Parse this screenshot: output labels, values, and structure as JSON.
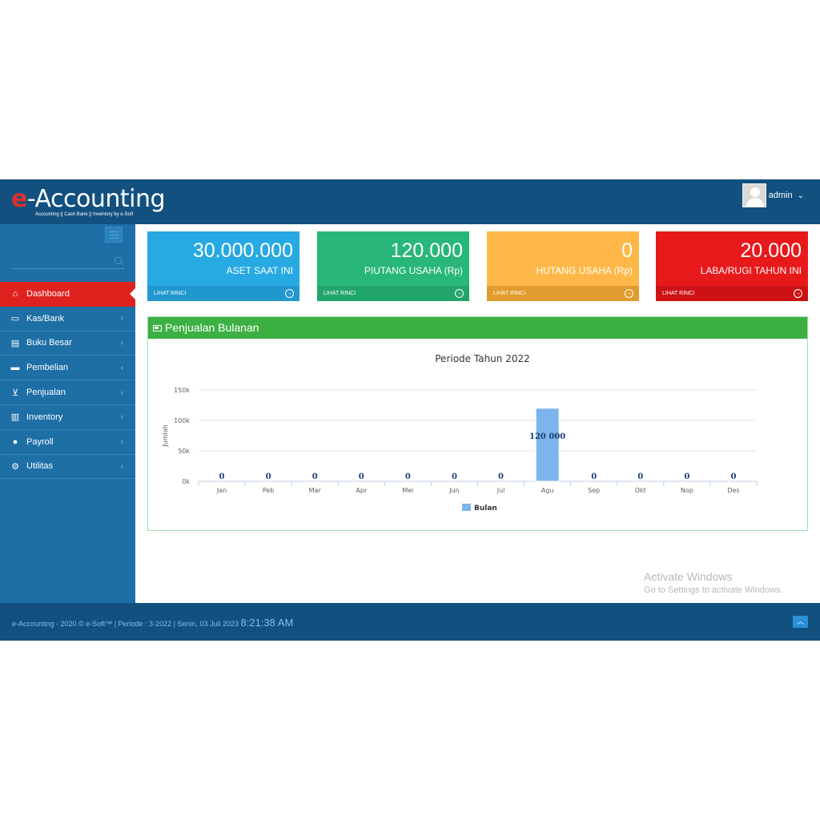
{
  "app": {
    "logo_prefix": "e",
    "logo_rest": "-Accounting",
    "logo_subtitle": "Accounting || Cash Bank || Inventory by e-Soft"
  },
  "user": {
    "name": "admin"
  },
  "sidebar": {
    "search_placeholder": "",
    "items": [
      {
        "label": "Dashboard",
        "icon": "home-icon",
        "active": true
      },
      {
        "label": "Kas/Bank",
        "icon": "money-icon"
      },
      {
        "label": "Buku Besar",
        "icon": "book-icon"
      },
      {
        "label": "Pembelian",
        "icon": "truck-icon"
      },
      {
        "label": "Penjualan",
        "icon": "cart-icon"
      },
      {
        "label": "Inventory",
        "icon": "barcode-icon"
      },
      {
        "label": "Payroll",
        "icon": "users-icon"
      },
      {
        "label": "Utilitas",
        "icon": "cogs-icon"
      }
    ]
  },
  "tiles": [
    {
      "value": "30.000.000",
      "label": "ASET SAAT INI",
      "link": "LIHAT RINCI",
      "color": "#27a9e3"
    },
    {
      "value": "120.000",
      "label": "PIUTANG USAHA (Rp)",
      "link": "LIHAT RINCI",
      "color": "#28b779"
    },
    {
      "value": "0",
      "label": "HUTANG USAHA (Rp)",
      "link": "LIHAT RINCI",
      "color": "#ffb848"
    },
    {
      "value": "20.000",
      "label": "LABA/RUGI TAHUN INI",
      "link": "LIHAT RINCI",
      "color": "#e7191b"
    }
  ],
  "panel": {
    "title": "Penjualan Bulanan"
  },
  "chart_data": {
    "type": "bar",
    "title": "Periode Tahun 2022",
    "ylabel": "Jumlah",
    "xlabel": "",
    "ylim": [
      0,
      150000
    ],
    "yticks": [
      "0k",
      "50k",
      "100k",
      "150k"
    ],
    "categories": [
      "Jan",
      "Peb",
      "Mar",
      "Apr",
      "Mei",
      "Jun",
      "Jul",
      "Agu",
      "Sep",
      "Okt",
      "Nop",
      "Des"
    ],
    "series": [
      {
        "name": "Bulan",
        "color": "#7cb5ec",
        "values": [
          0,
          0,
          0,
          0,
          0,
          0,
          0,
          120000,
          0,
          0,
          0,
          0
        ]
      }
    ],
    "data_labels": [
      "0",
      "0",
      "0",
      "0",
      "0",
      "0",
      "0",
      "120 000",
      "0",
      "0",
      "0",
      "0"
    ],
    "grid": true,
    "legend": "bottom-center"
  },
  "watermark": {
    "title": "Activate Windows",
    "subtitle": "Go to Settings to activate Windows."
  },
  "footer": {
    "text": "e-Accounting - 2020 © e-Soft™ | Periode : 3-2022 | Senin, 03 Juli 2023",
    "time": "8:21:38 AM",
    "scroll_icon": "chevron-up-icon"
  }
}
